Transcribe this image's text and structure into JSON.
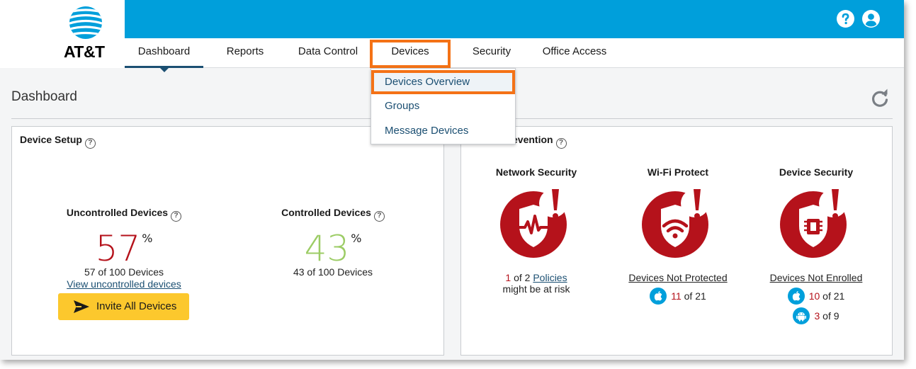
{
  "brand": {
    "name": "AT&T",
    "header_color": "#009fdb",
    "accent": "#f47216",
    "alert_red": "#b5121b"
  },
  "header": {
    "help_icon": "help-icon",
    "user_icon": "user-icon"
  },
  "nav": {
    "items": [
      {
        "label": "Dashboard",
        "active": true
      },
      {
        "label": "Reports"
      },
      {
        "label": "Data Control"
      },
      {
        "label": "Devices",
        "highlighted": true
      },
      {
        "label": "Security"
      },
      {
        "label": "Office Access"
      }
    ]
  },
  "devices_menu": {
    "items": [
      {
        "label": "Devices Overview",
        "selected": true
      },
      {
        "label": "Groups"
      },
      {
        "label": "Message Devices"
      }
    ]
  },
  "page": {
    "title": "Dashboard"
  },
  "device_setup": {
    "title": "Device Setup",
    "uncontrolled": {
      "label": "Uncontrolled Devices",
      "value": "57",
      "unit": "%",
      "sub": "57 of 100 Devices",
      "link": "View uncontrolled devices",
      "color": "#b5121b"
    },
    "controlled": {
      "label": "Controlled Devices",
      "value": "43",
      "unit": "%",
      "sub": "43 of 100 Devices",
      "color": "#9ccc65"
    },
    "invite_button": "Invite All Devices"
  },
  "threat_prevention": {
    "title_partial": "evention",
    "network_security": {
      "title": "Network Security",
      "count": "1",
      "of_text": " of 2 ",
      "link": "Policies",
      "line2": "might be at risk"
    },
    "wifi_protect": {
      "title": "Wi-Fi Protect",
      "link": "Devices Not Protected",
      "ios_count": "11",
      "ios_of": " of 21"
    },
    "device_security": {
      "title": "Device Security",
      "link": "Devices Not Enrolled",
      "ios_count": "10",
      "ios_of": " of 21",
      "android_count": "3",
      "android_of": " of 9"
    }
  }
}
